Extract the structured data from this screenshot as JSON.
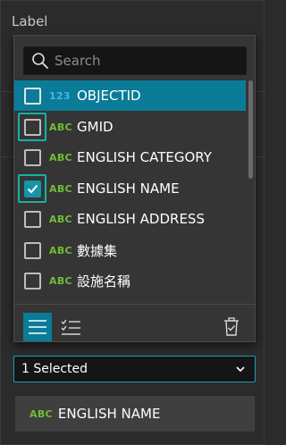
{
  "background": {
    "label": "Label"
  },
  "search": {
    "placeholder": "Search"
  },
  "fields": [
    {
      "type": "123",
      "kind": "num",
      "name": "OBJECTID",
      "checked": false,
      "highlighted": true,
      "focused": false
    },
    {
      "type": "ABC",
      "kind": "txt",
      "name": "GMID",
      "checked": false,
      "highlighted": false,
      "focused": true
    },
    {
      "type": "ABC",
      "kind": "txt",
      "name": "ENGLISH CATEGORY",
      "checked": false,
      "highlighted": false,
      "focused": false
    },
    {
      "type": "ABC",
      "kind": "txt",
      "name": "ENGLISH NAME",
      "checked": true,
      "highlighted": false,
      "focused": true
    },
    {
      "type": "ABC",
      "kind": "txt",
      "name": "ENGLISH ADDRESS",
      "checked": false,
      "highlighted": false,
      "focused": false
    },
    {
      "type": "ABC",
      "kind": "txt",
      "name": "數據集",
      "checked": false,
      "highlighted": false,
      "focused": false
    },
    {
      "type": "ABC",
      "kind": "txt",
      "name": "設施名稱",
      "checked": false,
      "highlighted": false,
      "focused": false
    },
    {
      "type": "",
      "kind": "txt",
      "name": "",
      "checked": false,
      "highlighted": false,
      "focused": false
    }
  ],
  "footer": {
    "list_icon": "list-icon",
    "checklist_icon": "checklist-icon",
    "clear_icon": "clear-selection-icon"
  },
  "select": {
    "value": "1 Selected"
  },
  "chip": {
    "type": "ABC",
    "name": "ENGLISH NAME"
  },
  "colors": {
    "accent": "#0b7c98",
    "focus": "#18b1a3",
    "number_type": "#43b5ec",
    "text_type": "#6fbf35"
  }
}
